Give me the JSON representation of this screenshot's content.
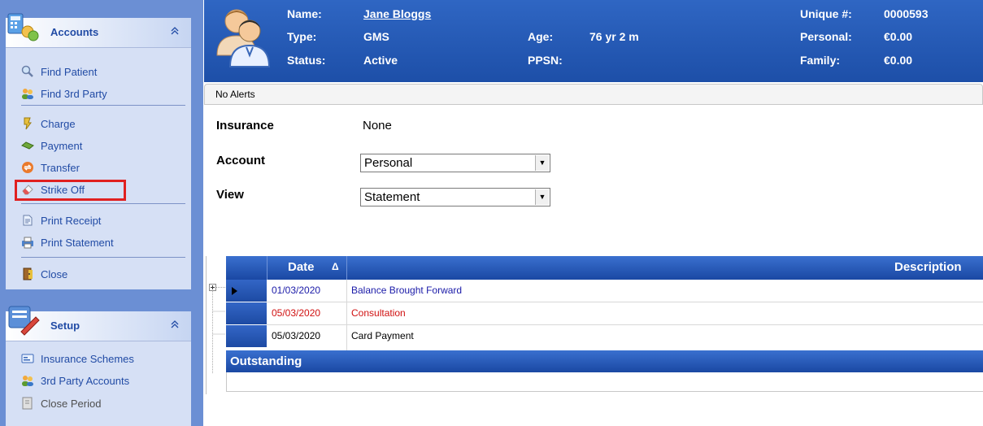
{
  "sidebar": {
    "accounts": {
      "title": "Accounts",
      "items": [
        {
          "label": "Find Patient"
        },
        {
          "label": "Find 3rd Party"
        },
        {
          "label": "Charge"
        },
        {
          "label": "Payment"
        },
        {
          "label": "Transfer"
        },
        {
          "label": "Strike Off"
        },
        {
          "label": "Print Receipt"
        },
        {
          "label": "Print Statement"
        },
        {
          "label": "Close"
        }
      ]
    },
    "setup": {
      "title": "Setup",
      "items": [
        {
          "label": "Insurance Schemes"
        },
        {
          "label": "3rd Party Accounts"
        },
        {
          "label": "Close Period"
        }
      ]
    },
    "collapse_glyph": "»"
  },
  "patient": {
    "name_label": "Name:",
    "name": "Jane Bloggs",
    "type_label": "Type:",
    "type": "GMS",
    "status_label": "Status:",
    "status": "Active",
    "age_label": "Age:",
    "age": "76 yr 2 m",
    "ppsn_label": "PPSN:",
    "ppsn": "",
    "unique_label": "Unique #:",
    "unique": "0000593",
    "personal_label": "Personal:",
    "personal": "€0.00",
    "family_label": "Family:",
    "family": "€0.00"
  },
  "alerts": "No Alerts",
  "form": {
    "insurance_label": "Insurance",
    "insurance_value": "None",
    "account_label": "Account",
    "account_value": "Personal",
    "view_label": "View",
    "view_value": "Statement"
  },
  "grid": {
    "date_header": "Date",
    "sort_glyph": "Δ",
    "description_header": "Description",
    "rows": [
      {
        "date": "01/03/2020",
        "description": "Balance Brought Forward",
        "color": "#1a1aa8"
      },
      {
        "date": "05/03/2020",
        "description": "Consultation",
        "color": "#d01010"
      },
      {
        "date": "05/03/2020",
        "description": "Card Payment",
        "color": "#000000"
      }
    ],
    "outstanding_label": "Outstanding"
  },
  "colors": {
    "sidebar_bg": "#6b8fd4",
    "header_blue": "#1d4fa8",
    "highlight_red": "#e02020"
  }
}
